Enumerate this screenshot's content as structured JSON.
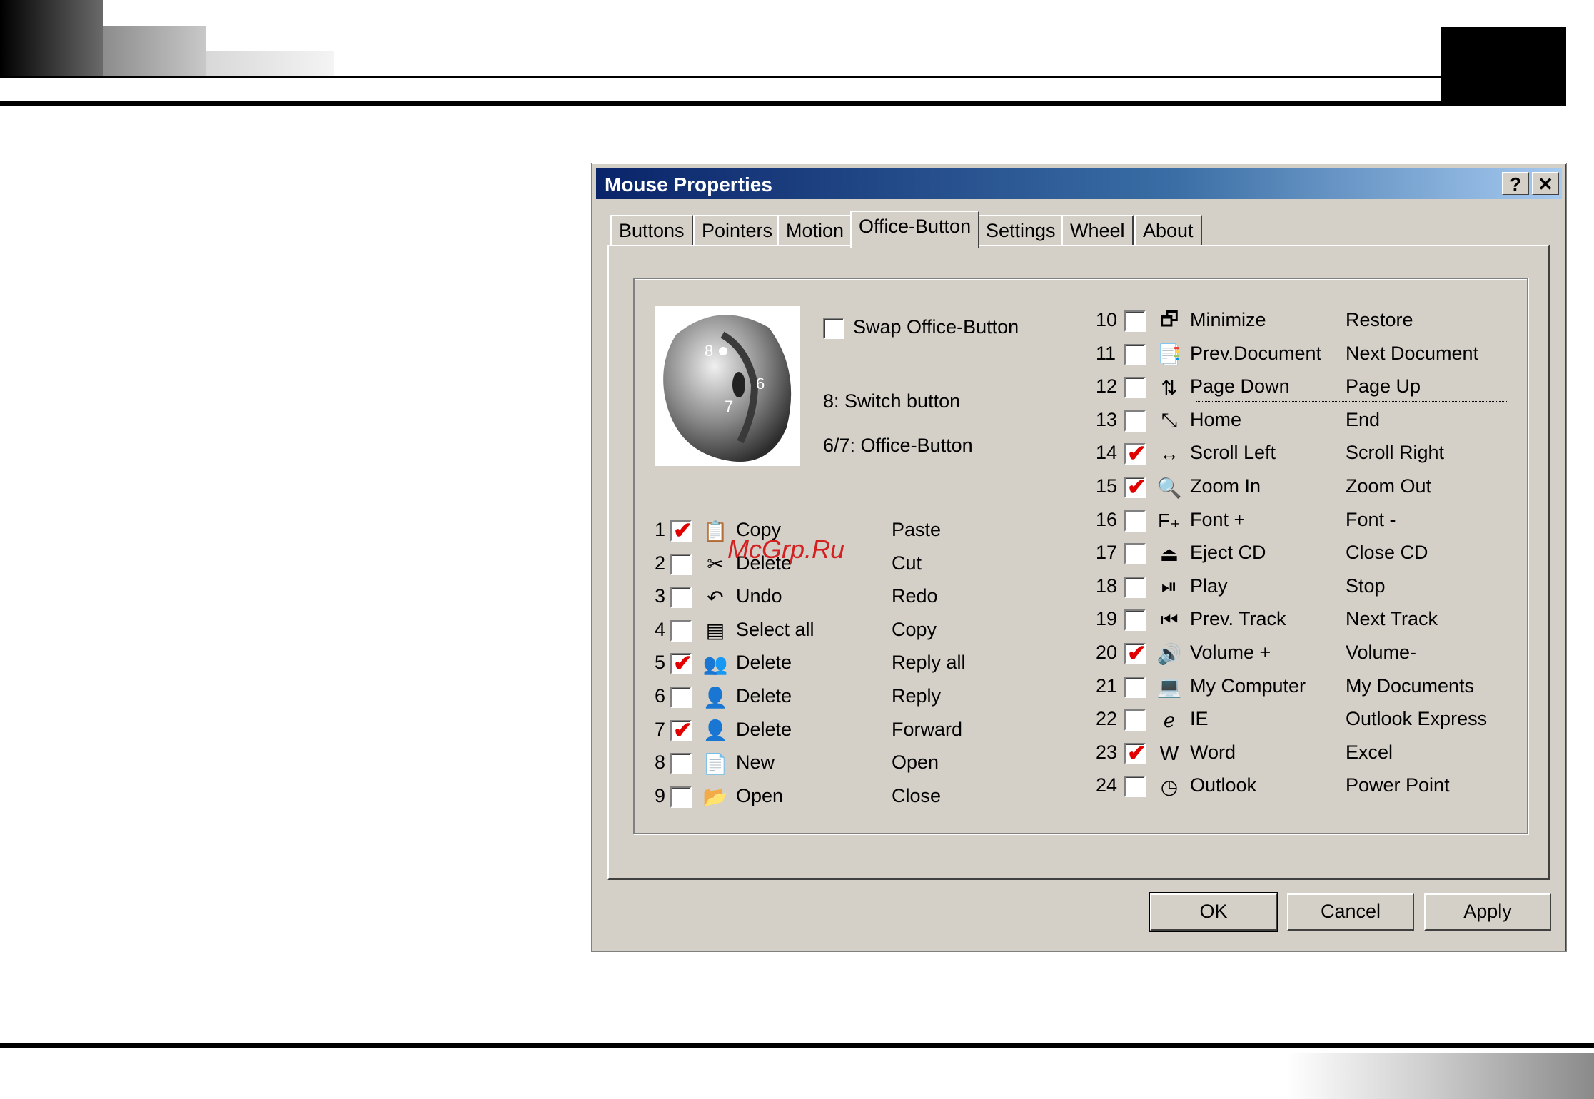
{
  "dialog": {
    "title": "Mouse Properties",
    "help_btn": "?",
    "close_btn": "✕",
    "tabs": [
      "Buttons",
      "Pointers",
      "Motion",
      "Office-Button",
      "Settings",
      "Wheel",
      "About"
    ],
    "swap_label": "Swap Office-Button",
    "note1": "8: Switch button",
    "note2": "6/7: Office-Button",
    "mouse_labels": {
      "a": "8",
      "b": "6",
      "c": "7"
    },
    "ok": "OK",
    "cancel": "Cancel",
    "apply": "Apply"
  },
  "watermark": "McGrp.Ru",
  "left_rows": [
    {
      "num": "1",
      "checked": true,
      "icon": "copy-icon",
      "glyph": "📋",
      "a": "Copy",
      "b": "Paste"
    },
    {
      "num": "2",
      "checked": false,
      "icon": "scissors-icon",
      "glyph": "✂",
      "a": "Delete",
      "b": "Cut"
    },
    {
      "num": "3",
      "checked": false,
      "icon": "undo-icon",
      "glyph": "↶",
      "a": "Undo",
      "b": "Redo"
    },
    {
      "num": "4",
      "checked": false,
      "icon": "select-all-icon",
      "glyph": "▤",
      "a": "Select all",
      "b": "Copy"
    },
    {
      "num": "5",
      "checked": true,
      "icon": "reply-all-icon",
      "glyph": "👥",
      "a": "Delete",
      "b": "Reply all"
    },
    {
      "num": "6",
      "checked": false,
      "icon": "reply-icon",
      "glyph": "👤",
      "a": "Delete",
      "b": "Reply"
    },
    {
      "num": "7",
      "checked": true,
      "icon": "forward-icon",
      "glyph": "👤",
      "a": "Delete",
      "b": "Forward"
    },
    {
      "num": "8",
      "checked": false,
      "icon": "new-document-icon",
      "glyph": "📄",
      "a": "New",
      "b": "Open"
    },
    {
      "num": "9",
      "checked": false,
      "icon": "open-folder-icon",
      "glyph": "📂",
      "a": "Open",
      "b": "Close"
    }
  ],
  "right_rows": [
    {
      "num": "10",
      "checked": false,
      "icon": "minimize-icon",
      "glyph": "🗗",
      "a": "Minimize",
      "b": "Restore"
    },
    {
      "num": "11",
      "checked": false,
      "icon": "document-icon",
      "glyph": "📑",
      "a": "Prev.Document",
      "b": "Next Document"
    },
    {
      "num": "12",
      "checked": false,
      "icon": "page-icon",
      "glyph": "⇅",
      "a": "Page Down",
      "b": "Page Up"
    },
    {
      "num": "13",
      "checked": false,
      "icon": "home-end-icon",
      "glyph": "⤡",
      "a": "Home",
      "b": "End"
    },
    {
      "num": "14",
      "checked": true,
      "icon": "scroll-icon",
      "glyph": "↔",
      "a": "Scroll Left",
      "b": "Scroll Right"
    },
    {
      "num": "15",
      "checked": true,
      "icon": "zoom-icon",
      "glyph": "🔍",
      "a": "Zoom In",
      "b": "Zoom Out"
    },
    {
      "num": "16",
      "checked": false,
      "icon": "font-icon",
      "glyph": "F₊",
      "a": "Font +",
      "b": "Font -"
    },
    {
      "num": "17",
      "checked": false,
      "icon": "eject-icon",
      "glyph": "⏏",
      "a": "Eject CD",
      "b": "Close CD"
    },
    {
      "num": "18",
      "checked": false,
      "icon": "play-pause-icon",
      "glyph": "⏯",
      "a": "Play",
      "b": "Stop"
    },
    {
      "num": "19",
      "checked": false,
      "icon": "previous-track-icon",
      "glyph": "⏮",
      "a": "Prev. Track",
      "b": "Next Track"
    },
    {
      "num": "20",
      "checked": true,
      "icon": "volume-icon",
      "glyph": "🔊",
      "a": "Volume +",
      "b": "Volume-"
    },
    {
      "num": "21",
      "checked": false,
      "icon": "computer-icon",
      "glyph": "💻",
      "a": "My Computer",
      "b": "My Documents"
    },
    {
      "num": "22",
      "checked": false,
      "icon": "ie-icon",
      "glyph": "ℯ",
      "a": "IE",
      "b": "Outlook Express"
    },
    {
      "num": "23",
      "checked": true,
      "icon": "word-icon",
      "glyph": "W",
      "a": "Word",
      "b": "Excel"
    },
    {
      "num": "24",
      "checked": false,
      "icon": "outlook-icon",
      "glyph": "◷",
      "a": "Outlook",
      "b": "Power Point"
    }
  ]
}
